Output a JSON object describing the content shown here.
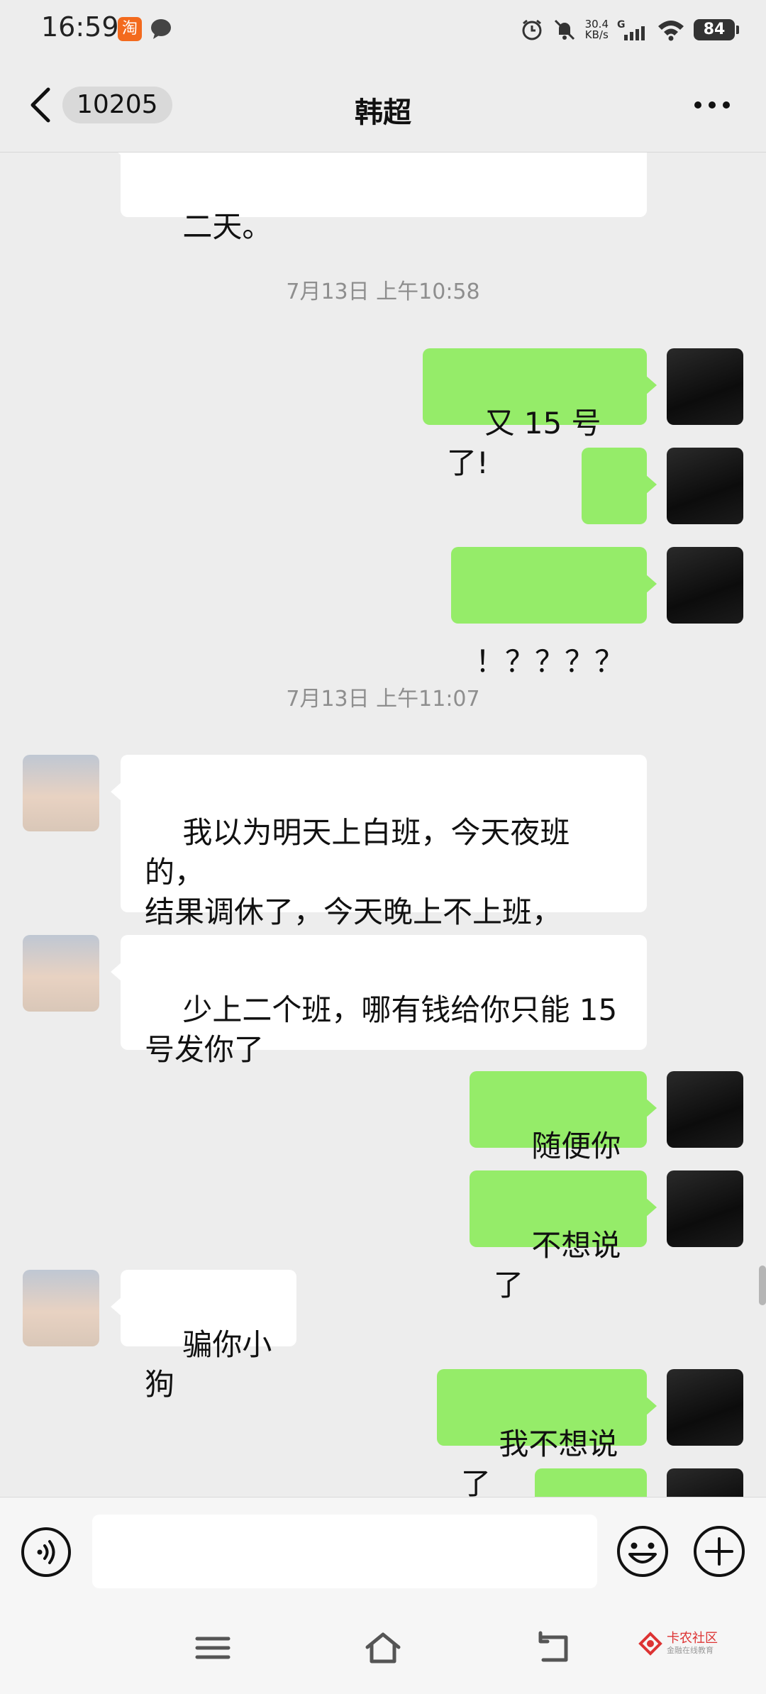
{
  "status_bar": {
    "time": "16:59",
    "taobao_icon_glyph": "淘",
    "net_speed_value": "30.4",
    "net_speed_unit": "KB/s",
    "network_type": "G",
    "battery": "84"
  },
  "header": {
    "back_count": "10205",
    "title": "韩超"
  },
  "messages": {
    "partial_top": "二天。",
    "ts1": "7月13日 上午10:58",
    "m1": "又 15 号了!",
    "m2": "?",
    "m3": "！？？？？",
    "ts2": "7月13日 上午11:07",
    "m4": "我以为明天上白班，今天夜班的，\n结果调休了，今天晚上不上班，\n明 天晚上才上班",
    "m5": "少上二个班，哪有钱给你只能 15\n号发你了",
    "m6": "随便你吧",
    "m7": "不想说了",
    "m8": "骗你小狗",
    "m9": "我不想说了"
  },
  "input": {
    "placeholder": ""
  },
  "watermark": {
    "line1": "卡农社区",
    "line2": "金融在线教育"
  },
  "colors": {
    "self_bubble": "#95ec69",
    "other_bubble": "#ffffff",
    "background": "#ededed"
  }
}
